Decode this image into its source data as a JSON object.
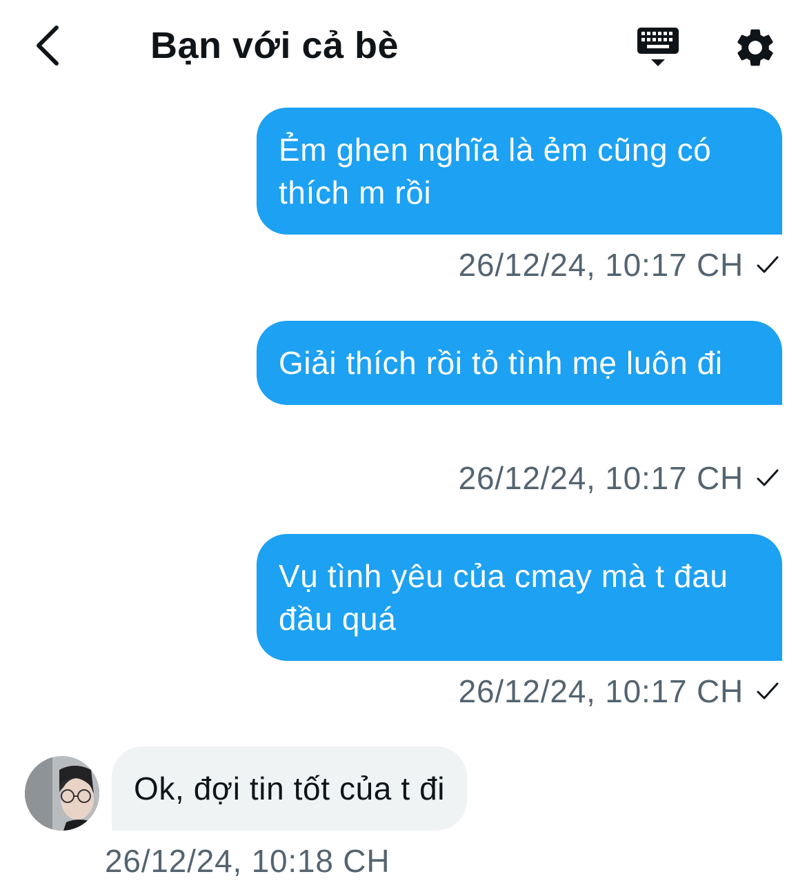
{
  "header": {
    "title": "Bạn với cả bè",
    "back_icon": "chevron-left-icon",
    "keyboard_icon": "keyboard-icon",
    "settings_icon": "gear-icon"
  },
  "messages": [
    {
      "direction": "sent",
      "text": "Ẻm ghen nghĩa là ẻm cũng có thích m rồi",
      "timestamp": "26/12/24, 10:17 CH",
      "status": "sent"
    },
    {
      "direction": "sent",
      "text": "Giải thích rồi tỏ tình mẹ luôn đi",
      "timestamp": "26/12/24, 10:17 CH",
      "status": "sent"
    },
    {
      "direction": "sent",
      "text": "Vụ tình yêu của cmay mà t đau đầu quá",
      "timestamp": "26/12/24, 10:17 CH",
      "status": "sent"
    },
    {
      "direction": "received",
      "text": "Ok, đợi tin tốt của t đi",
      "timestamp": "26/12/24, 10:18 CH"
    }
  ],
  "colors": {
    "sent_bubble": "#1da1f2",
    "received_bubble": "#eff3f4",
    "timestamp": "#536471",
    "text": "#0f1419"
  }
}
